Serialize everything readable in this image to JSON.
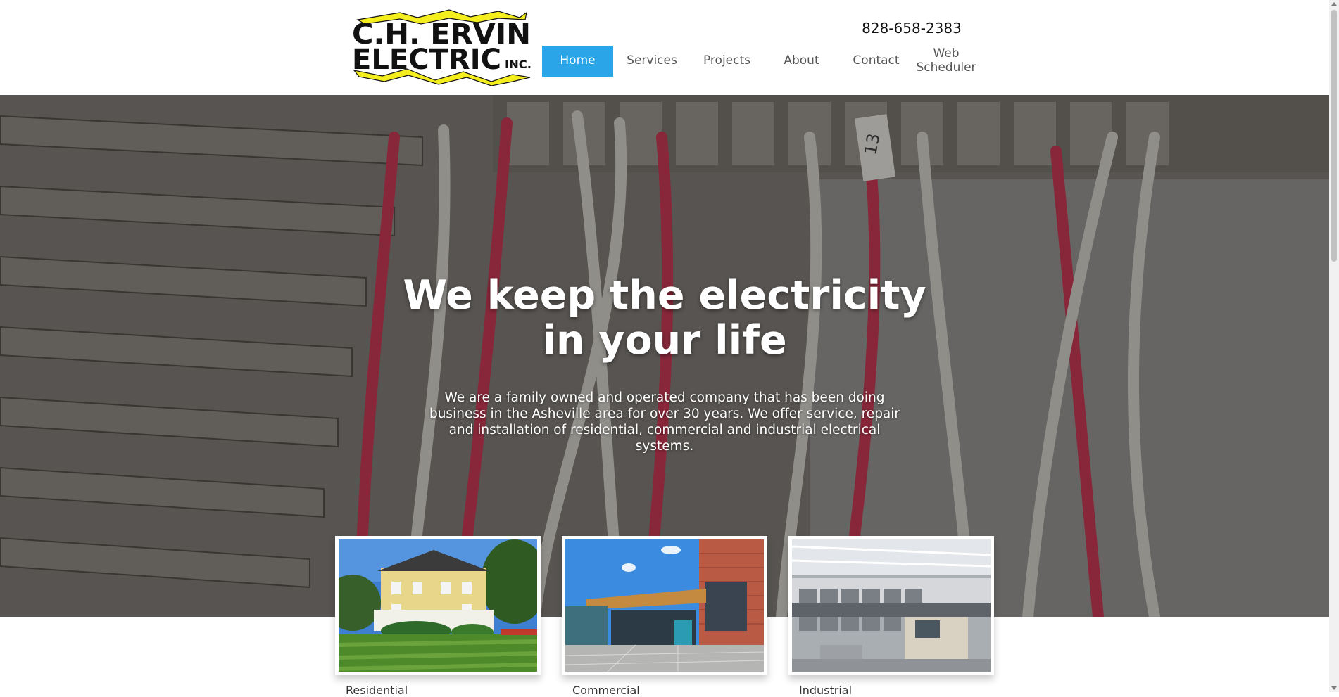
{
  "brand": {
    "logo_line1": "C.H. ERVIN",
    "logo_line2": "ELECTRIC",
    "logo_suffix": "INC.",
    "bolt_color": "#f5ee1f"
  },
  "header": {
    "phone": "828-658-2383"
  },
  "nav": {
    "items": [
      {
        "label": "Home",
        "active": true
      },
      {
        "label": "Services"
      },
      {
        "label": "Projects"
      },
      {
        "label": "About"
      },
      {
        "label": "Contact"
      },
      {
        "label": "Web Scheduler"
      }
    ],
    "accent_color": "#2aa6e8"
  },
  "hero": {
    "title": "We keep the electricity in your life",
    "text": "We are a family owned and operated company that has been doing business in the Asheville area for over 30 years. We offer service, repair and installation of residential, commercial and industrial electrical systems.",
    "wire_label": "13"
  },
  "cards": [
    {
      "label": "Residential",
      "icon": "house-photo"
    },
    {
      "label": "Commercial",
      "icon": "building-photo"
    },
    {
      "label": "Industrial",
      "icon": "factory-photo"
    }
  ]
}
